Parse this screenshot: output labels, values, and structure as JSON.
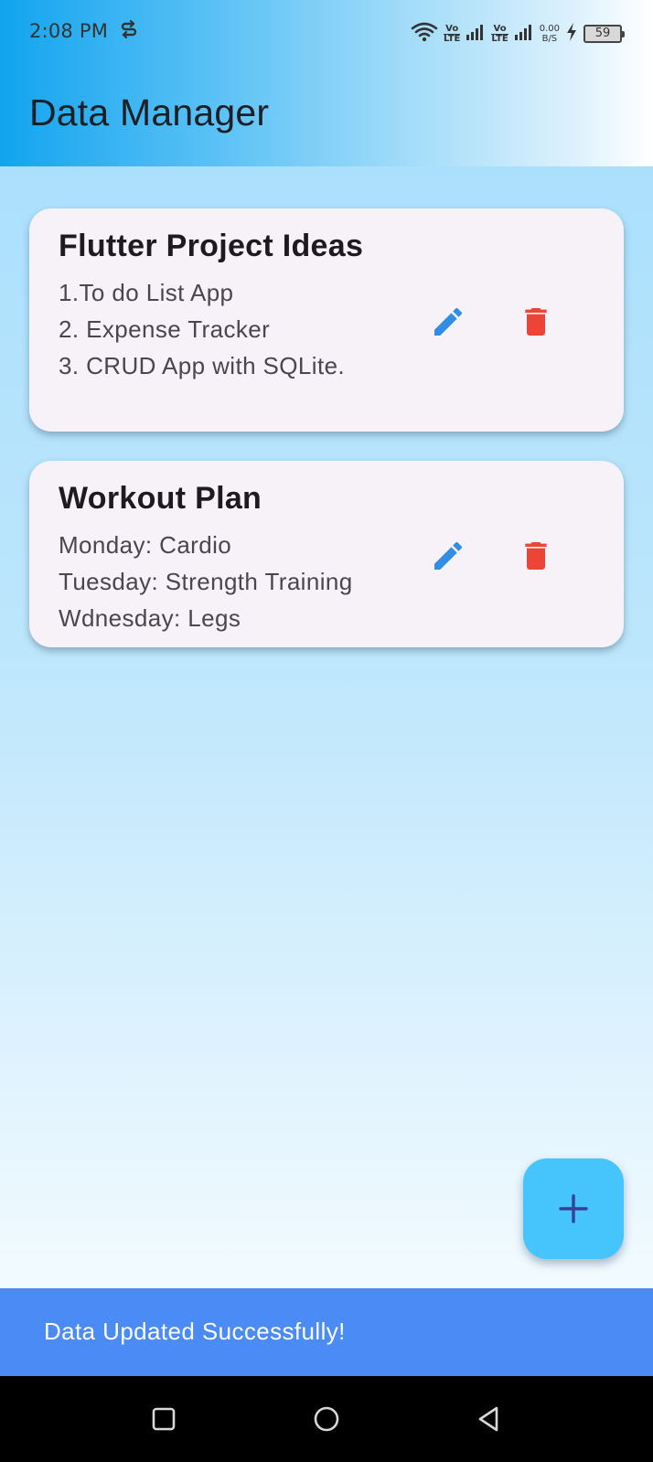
{
  "status_bar": {
    "time": "2:08 PM",
    "sync_icon": "S",
    "volte_top": "Vo",
    "volte_bottom": "LTE",
    "net_speed_value": "0.00",
    "net_speed_unit": "B/S",
    "battery_level": "59"
  },
  "app_bar": {
    "title": "Data Manager"
  },
  "cards": [
    {
      "title": "Flutter Project Ideas",
      "lines": [
        "1.To do List App",
        "2. Expense Tracker",
        "3. CRUD App with SQLite."
      ]
    },
    {
      "title": "Workout Plan",
      "lines": [
        "Monday: Cardio",
        "Tuesday: Strength Training",
        "Wdnesday: Legs"
      ]
    }
  ],
  "icons": {
    "edit": "pencil-icon",
    "delete": "trash-icon",
    "add": "plus-icon"
  },
  "colors": {
    "edit_icon": "#2f8ee5",
    "delete_icon": "#ec4436",
    "fab": "#45c5fc",
    "fab_icon": "#3a3f96",
    "snackbar": "#4a8bf5",
    "card": "#f7f1f8"
  },
  "snackbar": {
    "message": "Data Updated Successfully!"
  }
}
